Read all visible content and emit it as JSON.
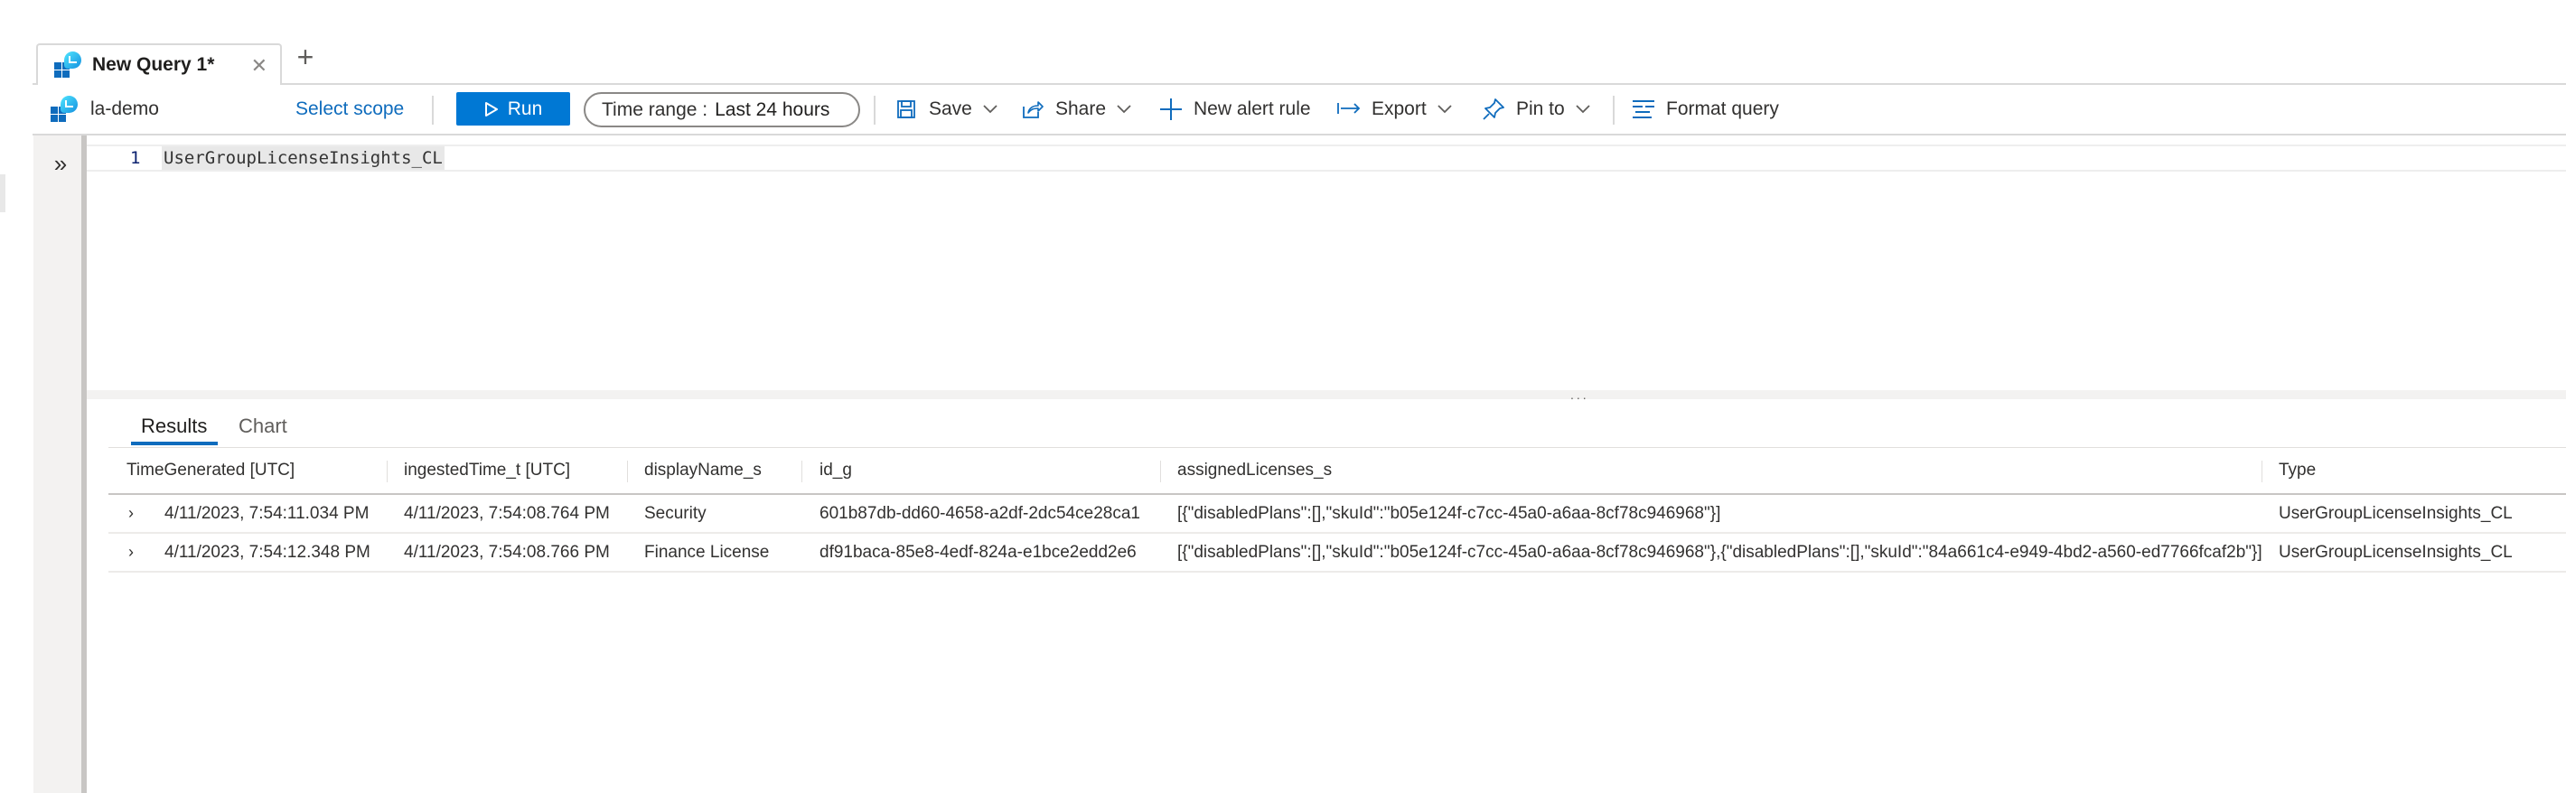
{
  "tabs": {
    "active": {
      "title": "New Query 1*",
      "icon": "log-analytics-icon",
      "close_icon": "close-icon"
    },
    "add_icon": "plus-icon"
  },
  "toolbar": {
    "workspace": {
      "name": "la-demo",
      "icon": "log-analytics-icon"
    },
    "select_scope": "Select scope",
    "run": {
      "label": "Run",
      "icon": "play-icon"
    },
    "time_range": {
      "label": "Time range :",
      "value": "Last 24 hours"
    },
    "save": {
      "label": "Save",
      "icon": "save-icon"
    },
    "share": {
      "label": "Share",
      "icon": "share-icon"
    },
    "new_alert_rule": {
      "label": "New alert rule",
      "icon": "plus-icon"
    },
    "export": {
      "label": "Export",
      "icon": "export-icon"
    },
    "pin_to": {
      "label": "Pin to",
      "icon": "pin-icon"
    },
    "format_query": {
      "label": "Format query",
      "icon": "format-icon"
    }
  },
  "sidebar": {
    "expand_icon": "double-chevron-right-icon"
  },
  "editor": {
    "lines": [
      {
        "number": "1",
        "text": "UserGroupLicenseInsights_CL"
      }
    ]
  },
  "splitter": {
    "handle": "..."
  },
  "results": {
    "tabs": [
      {
        "label": "Results",
        "active": true
      },
      {
        "label": "Chart",
        "active": false
      }
    ],
    "columns": [
      "TimeGenerated [UTC]",
      "ingestedTime_t [UTC]",
      "displayName_s",
      "id_g",
      "assignedLicenses_s",
      "Type"
    ],
    "rows": [
      [
        "4/11/2023, 7:54:11.034 PM",
        "4/11/2023, 7:54:08.764 PM",
        "Security",
        "601b87db-dd60-4658-a2df-2dc54ce28ca1",
        "[{\"disabledPlans\":[],\"skuId\":\"b05e124f-c7cc-45a0-a6aa-8cf78c946968\"}]",
        "UserGroupLicenseInsights_CL"
      ],
      [
        "4/11/2023, 7:54:12.348 PM",
        "4/11/2023, 7:54:08.766 PM",
        "Finance License",
        "df91baca-85e8-4edf-824a-e1bce2edd2e6",
        "[{\"disabledPlans\":[],\"skuId\":\"b05e124f-c7cc-45a0-a6aa-8cf78c946968\"},{\"disabledPlans\":[],\"skuId\":\"84a661c4-e949-4bd2-a560-ed7766fcaf2b\"}]",
        "UserGroupLicenseInsights_CL"
      ]
    ],
    "expander_icon": "chevron-right-icon"
  },
  "colors": {
    "accent": "#0078d4",
    "link": "#0f6cbd"
  }
}
